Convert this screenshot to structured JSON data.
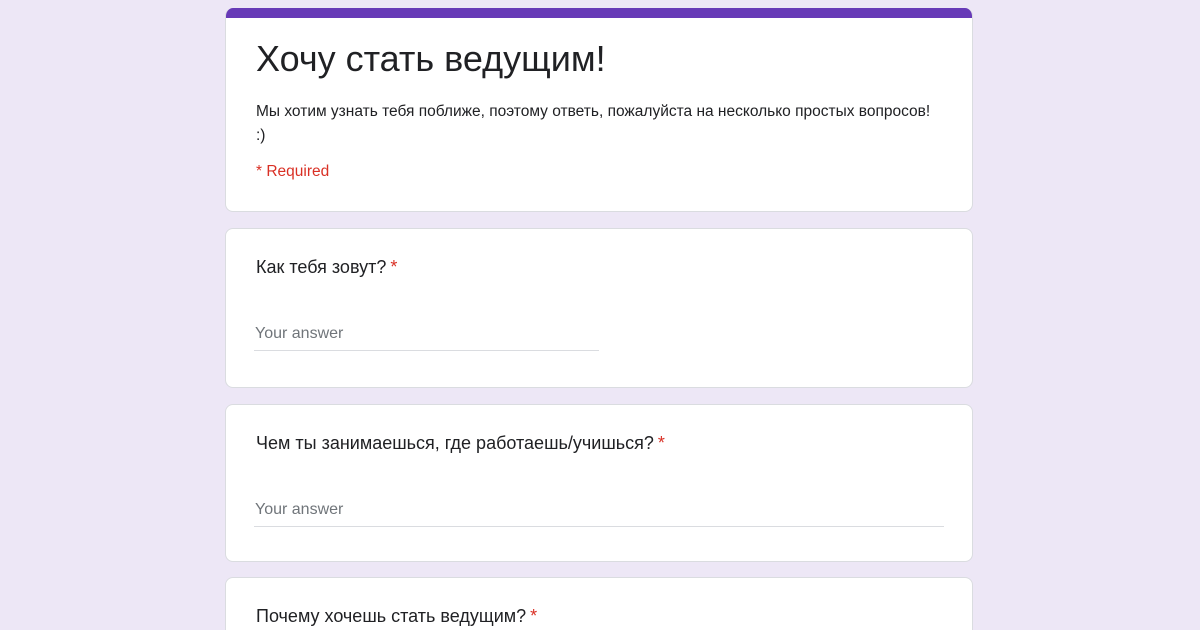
{
  "form": {
    "title": "Хочу стать ведущим!",
    "description": "Мы хотим узнать тебя поближе, поэтому ответь, пожалуйста на несколько простых вопросов! :)",
    "required_note": "* Required",
    "accent_color": "#673ab7",
    "background_color": "#ede7f6",
    "required_color": "#d93025"
  },
  "questions": [
    {
      "title": "Как тебя зовут?",
      "required_mark": "*",
      "placeholder": "Your answer"
    },
    {
      "title": "Чем ты занимаешься, где работаешь/учишься?",
      "required_mark": "*",
      "placeholder": "Your answer"
    },
    {
      "title": "Почему хочешь стать ведущим?",
      "required_mark": "*"
    }
  ]
}
